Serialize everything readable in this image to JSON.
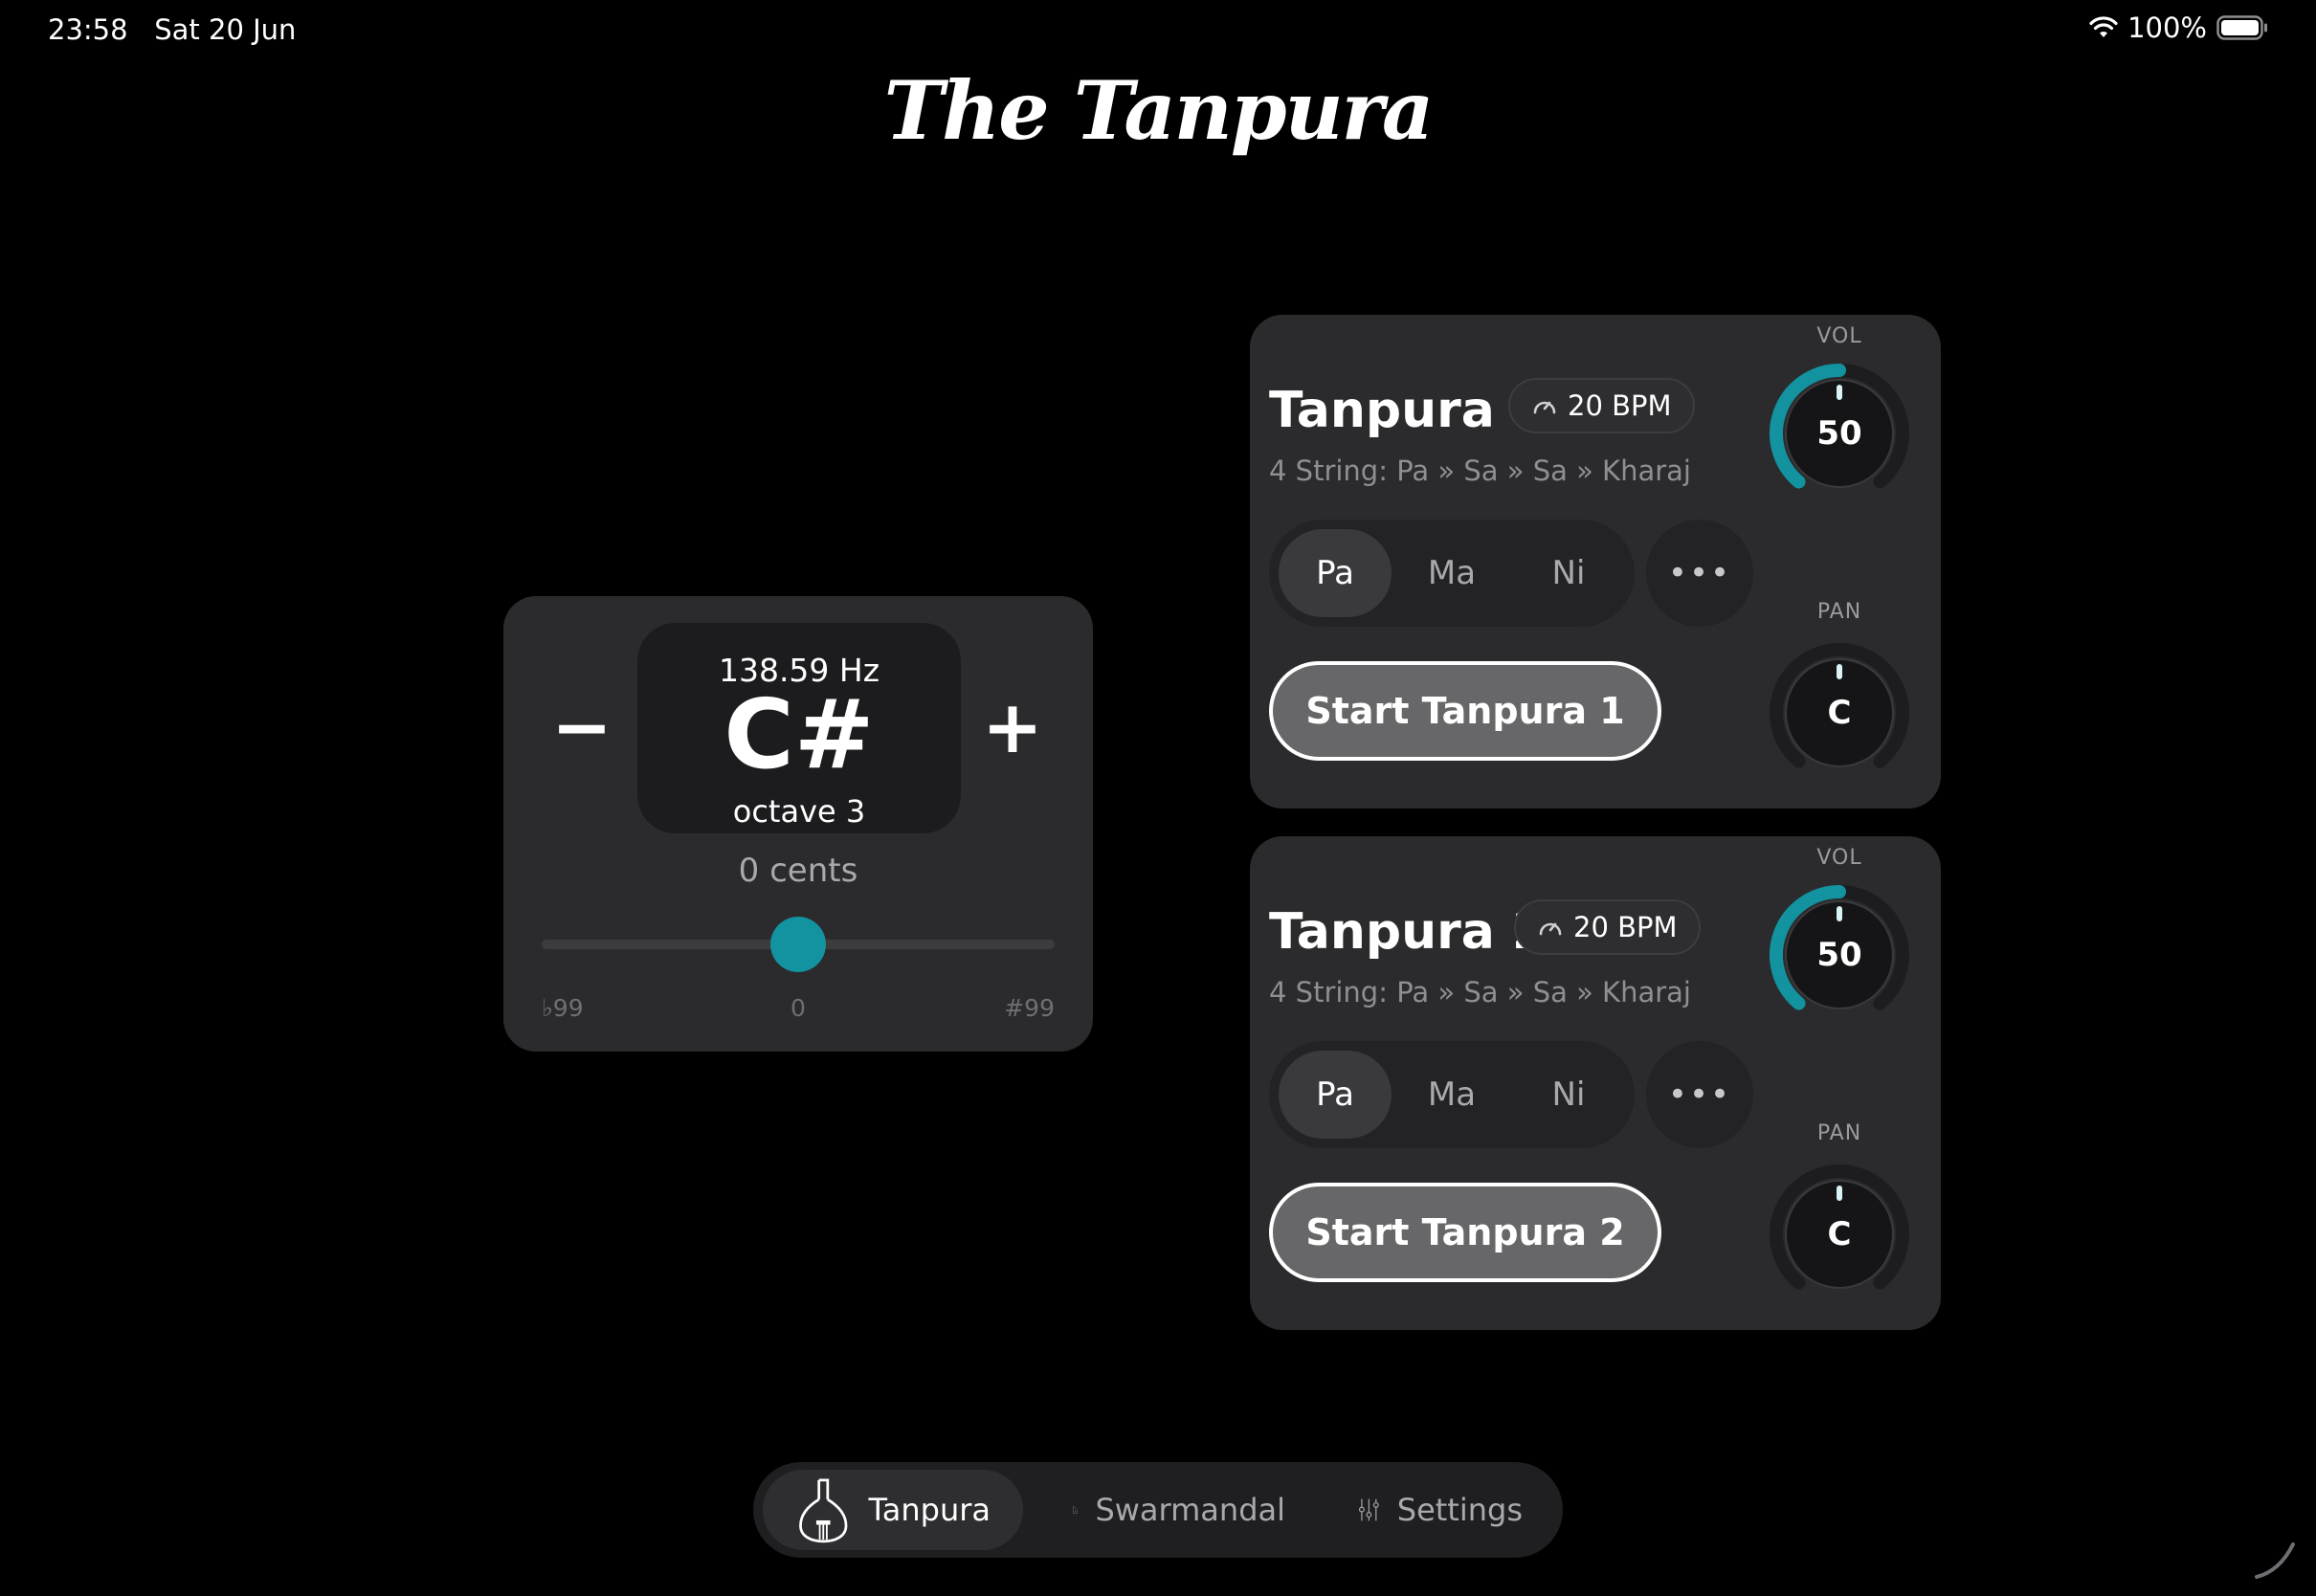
{
  "status": {
    "time": "23:58",
    "date": "Sat 20 Jun",
    "battery": "100%"
  },
  "app": {
    "logo": "The Tanpura"
  },
  "tuner": {
    "frequency": "138.59 Hz",
    "note": "C#",
    "octave": "octave 3",
    "cents_label": "0 cents",
    "cents_value": 0,
    "cents_min_label": "♭99",
    "cents_center_label": "0",
    "cents_max_label": "#99",
    "minus_label": "−",
    "plus_label": "+"
  },
  "tanpuras": [
    {
      "title": "Tanpura 1",
      "bpm": "20 BPM",
      "strings": "4 String: Pa » Sa » Sa » Kharaj",
      "options": [
        "Pa",
        "Ma",
        "Ni"
      ],
      "selected": "Pa",
      "more_label": "•••",
      "start_label": "Start Tanpura 1",
      "vol_label": "VOL",
      "vol_value": "50",
      "pan_label": "PAN",
      "pan_value": "C"
    },
    {
      "title": "Tanpura 2",
      "bpm": "20 BPM",
      "strings": "4 String: Pa » Sa » Sa » Kharaj",
      "options": [
        "Pa",
        "Ma",
        "Ni"
      ],
      "selected": "Pa",
      "more_label": "•••",
      "start_label": "Start Tanpura 2",
      "vol_label": "VOL",
      "vol_value": "50",
      "pan_label": "PAN",
      "pan_value": "C"
    }
  ],
  "tabs": [
    {
      "label": "Tanpura",
      "icon": "tanpura-icon",
      "active": true
    },
    {
      "label": "Swarmandal",
      "icon": "swarmandal-icon",
      "active": false
    },
    {
      "label": "Settings",
      "icon": "sliders-icon",
      "active": false
    }
  ],
  "colors": {
    "accent": "#13929f",
    "card": "#2b2b2d",
    "background": "#000000"
  }
}
